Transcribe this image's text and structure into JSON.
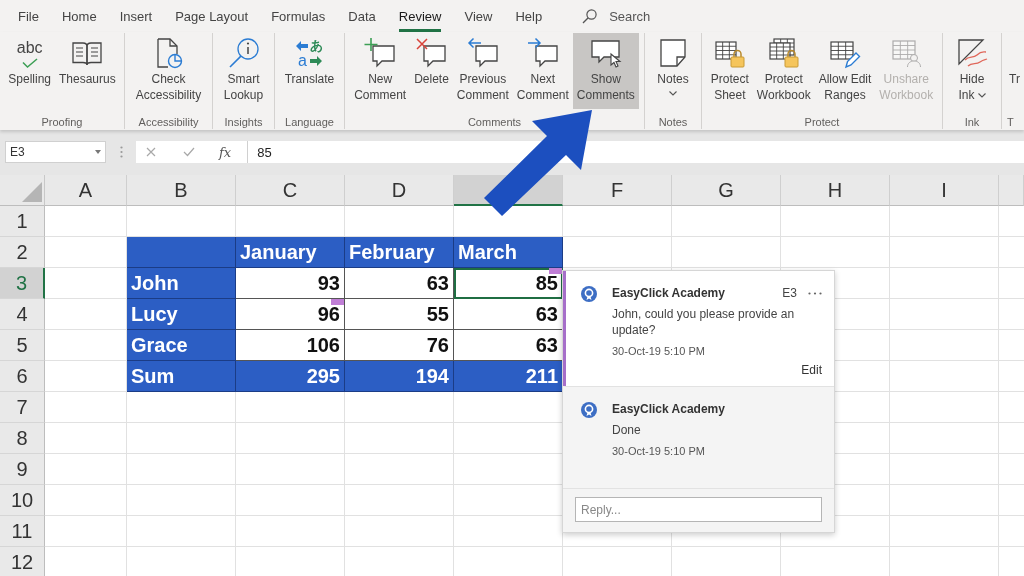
{
  "menu_tabs": [
    {
      "label": "File",
      "selected": false
    },
    {
      "label": "Home",
      "selected": false
    },
    {
      "label": "Insert",
      "selected": false
    },
    {
      "label": "Page Layout",
      "selected": false
    },
    {
      "label": "Formulas",
      "selected": false
    },
    {
      "label": "Data",
      "selected": false
    },
    {
      "label": "Review",
      "selected": true
    },
    {
      "label": "View",
      "selected": false
    },
    {
      "label": "Help",
      "selected": false
    }
  ],
  "search": {
    "placeholder": "Search"
  },
  "ribbon_groups": [
    {
      "label": "Proofing",
      "buttons": [
        {
          "label": "Spelling",
          "icon_text": [
            "abc"
          ],
          "on": false,
          "disabled": false,
          "dropdown": false
        },
        {
          "label": "Thesaurus",
          "on": false,
          "disabled": false,
          "dropdown": false
        }
      ]
    },
    {
      "label": "Accessibility",
      "buttons": [
        {
          "label": "Check Accessibility",
          "on": false,
          "disabled": false,
          "dropdown": false
        }
      ]
    },
    {
      "label": "Insights",
      "buttons": [
        {
          "label": "Smart Lookup",
          "on": false,
          "disabled": false,
          "dropdown": false
        }
      ]
    },
    {
      "label": "Language",
      "buttons": [
        {
          "label": "Translate",
          "icon_text": [
            "あ",
            "a"
          ],
          "on": false,
          "disabled": false,
          "dropdown": false
        }
      ]
    },
    {
      "label": "Comments",
      "buttons": [
        {
          "label": "New Comment",
          "on": false,
          "disabled": false,
          "dropdown": false
        },
        {
          "label": "Delete",
          "on": false,
          "disabled": false,
          "dropdown": false
        },
        {
          "label": "Previous Comment",
          "on": false,
          "disabled": false,
          "dropdown": false
        },
        {
          "label": "Next Comment",
          "on": false,
          "disabled": false,
          "dropdown": false
        },
        {
          "label": "Show Comments",
          "on": true,
          "disabled": false,
          "dropdown": false
        }
      ]
    },
    {
      "label": "Notes",
      "buttons": [
        {
          "label": "Notes",
          "on": false,
          "disabled": false,
          "dropdown": true
        }
      ]
    },
    {
      "label": "Protect",
      "buttons": [
        {
          "label": "Protect Sheet",
          "on": false,
          "disabled": false,
          "dropdown": false
        },
        {
          "label": "Protect Workbook",
          "on": false,
          "disabled": false,
          "dropdown": false
        },
        {
          "label": "Allow Edit Ranges",
          "on": false,
          "disabled": false,
          "dropdown": false
        },
        {
          "label": "Unshare Workbook",
          "on": false,
          "disabled": true,
          "dropdown": false
        }
      ]
    },
    {
      "label": "Ink",
      "buttons": [
        {
          "label": "Hide Ink",
          "on": false,
          "disabled": false,
          "dropdown": true
        }
      ]
    },
    {
      "label": "T",
      "buttons": [
        {
          "label": "Tr",
          "on": false,
          "disabled": false,
          "dropdown": false
        }
      ]
    }
  ],
  "formula_bar": {
    "name_box": "E3",
    "function_label": "fx",
    "value": "85"
  },
  "sheet": {
    "columns": [
      {
        "label": "A",
        "selected": false
      },
      {
        "label": "B",
        "selected": false
      },
      {
        "label": "C",
        "selected": false
      },
      {
        "label": "D",
        "selected": false
      },
      {
        "selected": true
      },
      {
        "label": "F",
        "selected": false
      },
      {
        "label": "G",
        "selected": false
      },
      {
        "label": "H",
        "selected": false
      },
      {
        "label": "I",
        "selected": false
      }
    ],
    "rows": [
      {
        "label": "1",
        "selected": false
      },
      {
        "label": "2",
        "selected": false
      },
      {
        "label": "3",
        "selected": true
      },
      {
        "label": "4",
        "selected": false
      },
      {
        "label": "5",
        "selected": false
      },
      {
        "label": "6",
        "selected": false
      },
      {
        "label": "7",
        "selected": false
      },
      {
        "label": "8",
        "selected": false
      },
      {
        "label": "9",
        "selected": false
      },
      {
        "label": "10",
        "selected": false
      },
      {
        "label": "11",
        "selected": false
      },
      {
        "label": "12",
        "selected": false
      }
    ]
  },
  "table": {
    "columns": [
      "January",
      "February",
      "March"
    ],
    "rows": [
      {
        "kind": "data",
        "name": "John",
        "cells": [
          {
            "value": "93",
            "comment": false,
            "selected": false
          },
          {
            "value": "63",
            "comment": false,
            "selected": false
          },
          {
            "value": "85",
            "comment": true,
            "selected": true
          }
        ]
      },
      {
        "kind": "data",
        "name": "Lucy",
        "cells": [
          {
            "value": "96",
            "comment": true,
            "selected": false
          },
          {
            "value": "55",
            "comment": false,
            "selected": false
          },
          {
            "value": "63",
            "comment": false,
            "selected": false
          }
        ]
      },
      {
        "kind": "data",
        "name": "Grace",
        "cells": [
          {
            "value": "106",
            "comment": false,
            "selected": false
          },
          {
            "value": "76",
            "comment": false,
            "selected": false
          },
          {
            "value": "63",
            "comment": false,
            "selected": false
          }
        ]
      },
      {
        "kind": "total",
        "name": "Sum",
        "cells": [
          {
            "value": "295",
            "comment": false,
            "selected": false
          },
          {
            "value": "194",
            "comment": false,
            "selected": false
          },
          {
            "value": "211",
            "comment": false,
            "selected": false
          }
        ]
      }
    ]
  },
  "comment_thread": {
    "comments": [
      {
        "kind": "comment",
        "author": "EasyClick Academy",
        "cell_ref": "E3",
        "text": "John, could you please provide an update?",
        "date": "30-Oct-19 5:10 PM",
        "action": "Edit"
      },
      {
        "kind": "reply",
        "author": "EasyClick Academy",
        "text": "Done",
        "date": "30-Oct-19 5:10 PM"
      }
    ],
    "reply": {
      "placeholder": "Reply..."
    }
  }
}
